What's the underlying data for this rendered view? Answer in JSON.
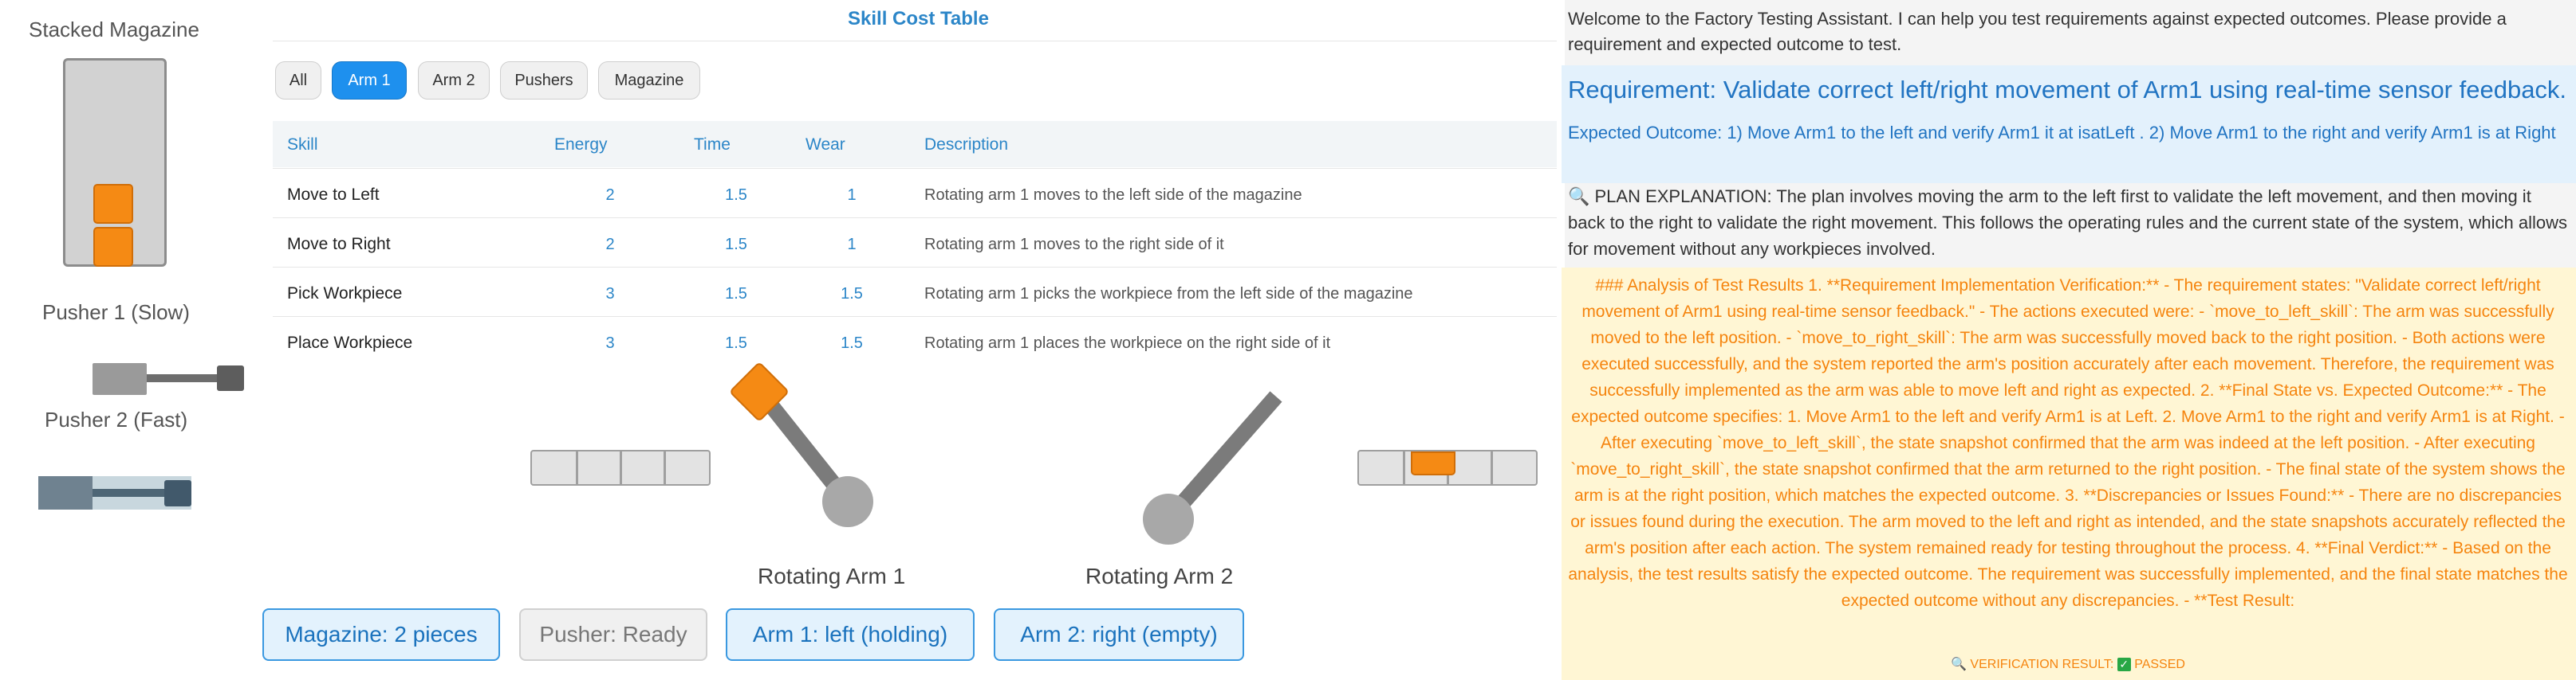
{
  "left": {
    "magazine_title": "Stacked Magazine",
    "pusher1_label": "Pusher 1 (Slow)",
    "pusher2_label": "Pusher 2 (Fast)"
  },
  "table": {
    "title": "Skill Cost Table",
    "filters": [
      {
        "label": "All",
        "active": false
      },
      {
        "label": "Arm 1",
        "active": true
      },
      {
        "label": "Arm 2",
        "active": false
      },
      {
        "label": "Pushers",
        "active": false
      },
      {
        "label": "Magazine",
        "active": false
      }
    ],
    "columns": [
      "Skill",
      "Energy",
      "Time",
      "Wear",
      "Description"
    ],
    "rows": [
      {
        "skill": "Move to Left",
        "energy": "2",
        "time": "1.5",
        "wear": "1",
        "description": "Rotating arm 1 moves to the left side of the magazine"
      },
      {
        "skill": "Move to Right",
        "energy": "2",
        "time": "1.5",
        "wear": "1",
        "description": "Rotating arm 1 moves to the right side of it"
      },
      {
        "skill": "Pick Workpiece",
        "energy": "3",
        "time": "1.5",
        "wear": "1.5",
        "description": "Rotating arm 1 picks the workpiece from the left side of the magazine"
      },
      {
        "skill": "Place Workpiece",
        "energy": "3",
        "time": "1.5",
        "wear": "1.5",
        "description": "Rotating arm 1 places the workpiece on the right side of it"
      }
    ]
  },
  "scene": {
    "arm1_label": "Rotating Arm 1",
    "arm2_label": "Rotating Arm 2"
  },
  "status": {
    "magazine": "Magazine: 2 pieces",
    "pusher": "Pusher: Ready",
    "arm1": "Arm 1: left (holding)",
    "arm2": "Arm 2: right (empty)"
  },
  "chat": {
    "welcome": "Welcome to the Factory Testing Assistant. I can help you test requirements against expected outcomes. Please provide a requirement and expected outcome to test.",
    "requirement": "Requirement: Validate correct left/right movement of Arm1 using real-time sensor feedback.",
    "expected": "Expected Outcome: 1) Move Arm1 to the left and verify Arm1 it at isatLeft . 2) Move Arm1 to the right and verify Arm1 is at Right",
    "plan": "🔍 PLAN EXPLANATION: The plan involves moving the arm to the left first to validate the left movement, and then moving it back to the right to validate the right movement. This follows the operating rules and the current state of the system, which allows for movement without any workpieces involved.",
    "analysis": "### Analysis of Test Results 1. **Requirement Implementation Verification:** - The requirement states: \"Validate correct left/right movement of Arm1 using real-time sensor feedback.\" - The actions executed were: - `move_to_left_skill`: The arm was successfully moved to the left position. - `move_to_right_skill`: The arm was successfully moved back to the right position. - Both actions were executed successfully, and the system reported the arm's position accurately after each movement. Therefore, the requirement was successfully implemented as the arm was able to move left and right as expected. 2. **Final State vs. Expected Outcome:** - The expected outcome specifies: 1. Move Arm1 to the left and verify Arm1 is at Left. 2. Move Arm1 to the right and verify Arm1 is at Right. - After executing `move_to_left_skill`, the state snapshot confirmed that the arm was indeed at the left position. - After executing `move_to_right_skill`, the state snapshot confirmed that the arm returned to the right position. - The final state of the system shows the arm is at the right position, which matches the expected outcome. 3. **Discrepancies or Issues Found:** - There are no discrepancies or issues found during the execution. The arm moved to the left and right as intended, and the state snapshots accurately reflected the arm's position after each action. The system remained ready for testing throughout the process. 4. **Final Verdict:** - Based on the analysis, the test results satisfy the expected outcome. The requirement was successfully implemented, and the final state matches the expected outcome without any discrepancies. - **Test Result:",
    "verdict_prefix": "🔍 VERIFICATION RESULT:",
    "verdict_check": "✓",
    "verdict_status": "PASSED"
  },
  "colors": {
    "accent": "#1e90ee",
    "workpiece": "#f58a14",
    "analysis_text": "#f5840e"
  }
}
